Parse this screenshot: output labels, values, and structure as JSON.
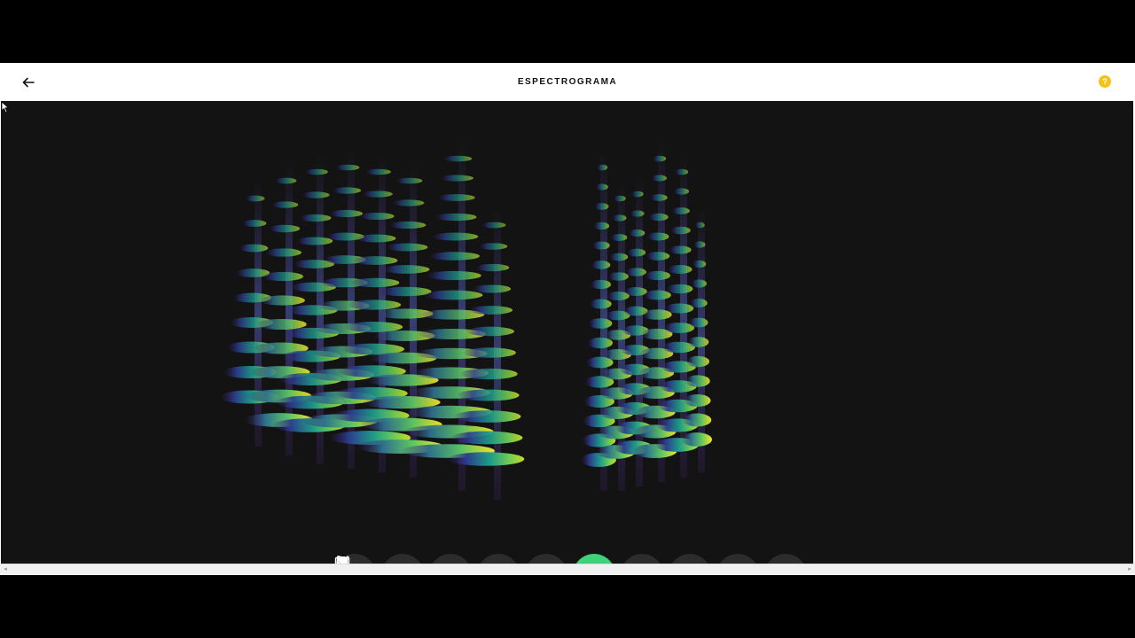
{
  "header": {
    "title": "ESPECTROGRAMA",
    "help_label": "?"
  },
  "colors": {
    "page_bg": "#000000",
    "header_bg": "#ffffff",
    "stage_bg": "#131313",
    "tool_bg": "#2c2c2c",
    "tool_active": "#3fd07a",
    "help_accent": "#f4c21b"
  },
  "toolbar": {
    "active_index": 5,
    "tools": [
      {
        "icon": "microphone-icon"
      },
      {
        "icon": "hand-pointer-icon"
      },
      {
        "icon": "flute-icon"
      },
      {
        "icon": "harp-icon"
      },
      {
        "icon": "face-icon"
      },
      {
        "icon": "trombone-icon"
      },
      {
        "icon": "synth-keyboard-icon"
      },
      {
        "icon": "bird-icon"
      },
      {
        "icon": "laptop-icon"
      },
      {
        "icon": "wine-glass-icon"
      }
    ]
  }
}
